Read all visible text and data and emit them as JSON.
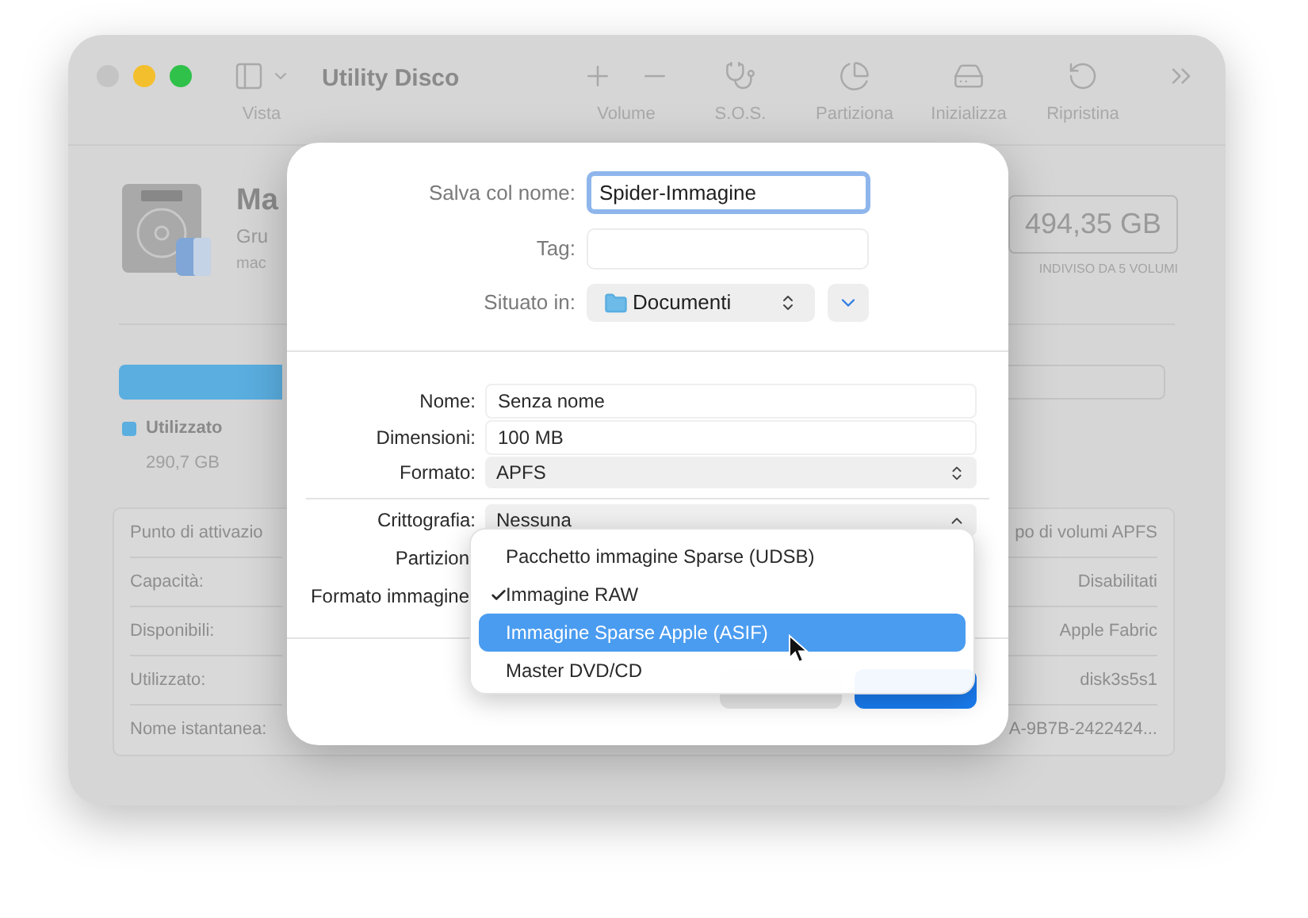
{
  "window": {
    "title": "Utility Disco"
  },
  "toolbar": {
    "view": {
      "label": "Vista"
    },
    "items": [
      {
        "kind": "volume",
        "label": "Volume"
      },
      {
        "kind": "sos",
        "label": "S.O.S."
      },
      {
        "kind": "partition",
        "label": "Partiziona"
      },
      {
        "kind": "erase",
        "label": "Inizializza"
      },
      {
        "kind": "restore",
        "label": "Ripristina"
      }
    ]
  },
  "volume": {
    "name": "Ma",
    "subtitle": "Gru",
    "detail": "mac",
    "capacity": "494,35 GB",
    "capacity_note": "INDIVISO DA 5 VOLUMI",
    "legend": {
      "label": "Utilizzato",
      "value": "290,7 GB",
      "color": "#5aaee0"
    }
  },
  "info": {
    "left": [
      "Punto di attivazio",
      "Capacità:",
      "Disponibili:",
      "Utilizzato:",
      "Nome istantanea:"
    ],
    "right": [
      "po di volumi APFS",
      "Disabilitati",
      "Apple Fabric",
      "disk3s5s1",
      "A-9B7B-2422424..."
    ]
  },
  "dialog": {
    "save_as": {
      "label": "Salva col nome:",
      "value": "Spider-Immagine"
    },
    "tags": {
      "label": "Tag:"
    },
    "location": {
      "label": "Situato in:",
      "value": "Documenti"
    },
    "fields": [
      {
        "kind": "text",
        "label": "Nome:",
        "value": "Senza nome"
      },
      {
        "kind": "text",
        "label": "Dimensioni:",
        "value": "100 MB"
      },
      {
        "kind": "popup",
        "label": "Formato:",
        "value": "APFS"
      }
    ],
    "options": [
      {
        "label": "Crittografia:",
        "value": "Nessuna"
      },
      {
        "label": "Partizion"
      },
      {
        "label": "Formato immagine"
      }
    ],
    "buttons": [
      {
        "kind": "cancel"
      },
      {
        "kind": "default"
      }
    ]
  },
  "menu": {
    "items": [
      {
        "label": "Pacchetto immagine Sparse (UDSB)",
        "checked": false,
        "selected": false
      },
      {
        "label": "Immagine RAW",
        "checked": true,
        "selected": false
      },
      {
        "label": "Immagine Sparse Apple (ASIF)",
        "checked": false,
        "selected": true
      },
      {
        "label": "Master DVD/CD",
        "checked": false,
        "selected": false
      }
    ]
  }
}
